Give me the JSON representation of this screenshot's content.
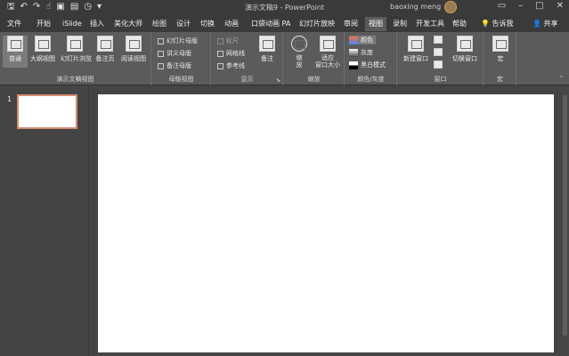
{
  "window": {
    "document_title": "演示文稿9 - PowerPoint",
    "user_name": "baoxing meng"
  },
  "quick_access": {
    "icons": [
      "save-icon",
      "undo-icon",
      "redo-icon",
      "touch-mode-icon",
      "slideshow-icon",
      "picture-icon",
      "timer-icon",
      "customize-icon"
    ]
  },
  "tabs": [
    {
      "label": "文件"
    },
    {
      "label": "开始"
    },
    {
      "label": "iSlide"
    },
    {
      "label": "插入"
    },
    {
      "label": "美化大师"
    },
    {
      "label": "绘图"
    },
    {
      "label": "设计"
    },
    {
      "label": "切换"
    },
    {
      "label": "动画"
    },
    {
      "label": "口袋动画 PA"
    },
    {
      "label": "幻灯片放映"
    },
    {
      "label": "审阅"
    },
    {
      "label": "视图",
      "active": true
    },
    {
      "label": "录制"
    },
    {
      "label": "开发工具"
    },
    {
      "label": "帮助"
    }
  ],
  "tell_me": "告诉我",
  "share": "共享",
  "ribbon": {
    "presentation_views": {
      "label": "演示文稿视图",
      "buttons": [
        "普通",
        "大纲视图",
        "幻灯片浏览",
        "备注页",
        "阅读视图"
      ]
    },
    "master_views": {
      "label": "母版视图",
      "items": [
        "幻灯片母版",
        "讲义母版",
        "备注母版"
      ]
    },
    "show": {
      "label": "显示",
      "items": [
        "标尺",
        "网格线",
        "参考线"
      ],
      "notes_button": "备注"
    },
    "zoom": {
      "label": "缩放",
      "zoom_button": "缩\n放",
      "fit_button": "适应\n窗口大小"
    },
    "color_gray": {
      "label": "颜色/灰度",
      "options": [
        "颜色",
        "灰度",
        "黑白模式"
      ]
    },
    "window": {
      "label": "窗口",
      "new_window": "新建窗口",
      "switch_windows": "切换窗口"
    },
    "macros": {
      "label": "宏",
      "button": "宏"
    }
  },
  "slides": {
    "current_number": "1"
  }
}
